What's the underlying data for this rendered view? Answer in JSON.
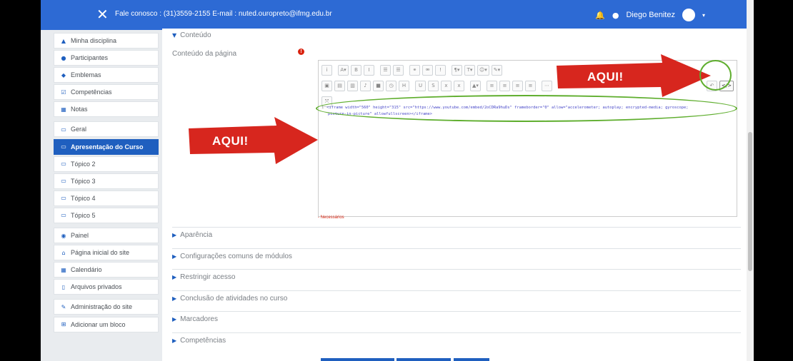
{
  "topbar": {
    "contact": "Fale conosco : (31)3559-2155  E-mail : nuted.ouropreto@ifmg.edu.br",
    "user_name": "Diego Benitez"
  },
  "sidebar": {
    "items": [
      {
        "label": "Minha disciplina",
        "icon": "graduation-cap-icon"
      },
      {
        "label": "Participantes",
        "icon": "users-icon"
      },
      {
        "label": "Emblemas",
        "icon": "shield-icon"
      },
      {
        "label": "Competências",
        "icon": "check-square-icon"
      },
      {
        "label": "Notas",
        "icon": "table-icon"
      },
      {
        "label": "Geral",
        "icon": "folder-icon"
      },
      {
        "label": "Apresentação do Curso",
        "icon": "folder-icon",
        "active": true
      },
      {
        "label": "Tópico 2",
        "icon": "folder-icon"
      },
      {
        "label": "Tópico 3",
        "icon": "folder-icon"
      },
      {
        "label": "Tópico 4",
        "icon": "folder-icon"
      },
      {
        "label": "Tópico 5",
        "icon": "folder-icon"
      },
      {
        "label": "Painel",
        "icon": "dashboard-icon"
      },
      {
        "label": "Página inicial do site",
        "icon": "home-icon"
      },
      {
        "label": "Calendário",
        "icon": "calendar-icon"
      },
      {
        "label": "Arquivos privados",
        "icon": "file-icon"
      },
      {
        "label": "Administração do site",
        "icon": "wrench-icon"
      },
      {
        "label": "Adicionar um bloco",
        "icon": "plus-square-icon"
      }
    ]
  },
  "main": {
    "section_conteudo": "Conteúdo",
    "field_label": "Conteúdo da página",
    "code_line1_plain": "<iframe width=",
    "code_line1": "<iframe width=\"560\" height=\"315\" src=\"https://www.youtube.com/embed/2oCDRa9huDs\" frameborder=\"0\" allow=\"accelerometer; autoplay; encrypted-media; gyroscope;",
    "code_line2": "picture-in-picture\" allowfullscreen></iframe>",
    "line_number": "1",
    "required_note": "- Necessários",
    "sections": [
      "Aparência",
      "Configurações comuns de módulos",
      "Restringir acesso",
      "Conclusão de atividades no curso",
      "Marcadores",
      "Competências"
    ]
  },
  "annotations": {
    "left_arrow": "AQUI!",
    "right_arrow": "AQUI!"
  },
  "colors": {
    "brand": "#2d6ad4",
    "active": "#1f5fbf",
    "arrow": "#d7261e",
    "highlight": "#5fae2e"
  }
}
